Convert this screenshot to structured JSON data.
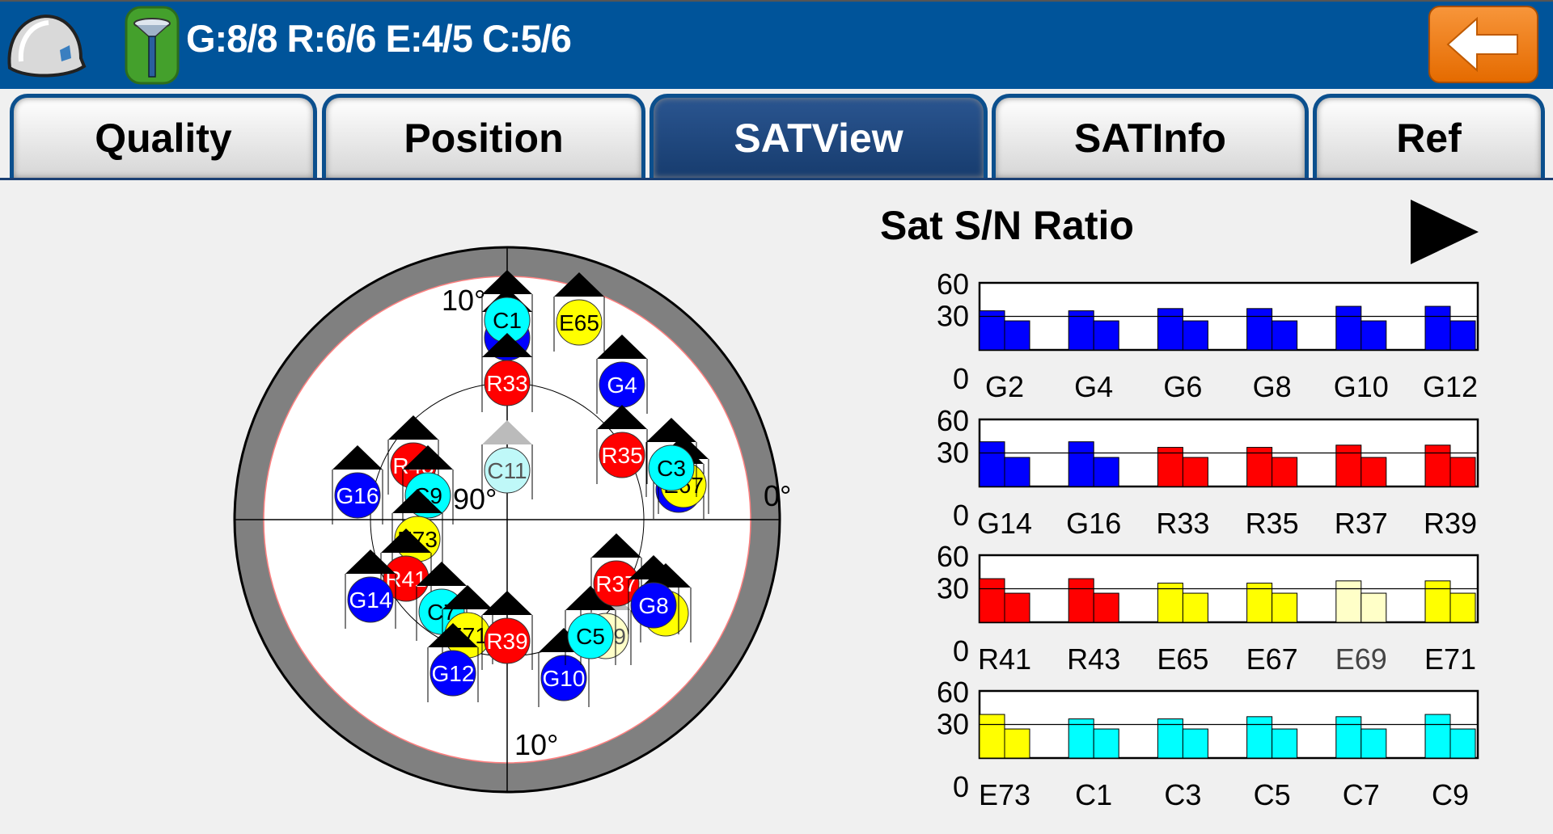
{
  "header": {
    "status": "G:8/8 R:6/6 E:4/5 C:5/6",
    "hat_icon": "hardhat-icon",
    "gps_icon": "gps-antenna-icon",
    "back_icon": "back-arrow-icon",
    "brand_color": "#00549a",
    "back_color": "#f07c1a"
  },
  "tabs": [
    {
      "label": "Quality",
      "active": false
    },
    {
      "label": "Position",
      "active": false
    },
    {
      "label": "SATView",
      "active": true
    },
    {
      "label": "SATInfo",
      "active": false
    },
    {
      "label": "Ref",
      "active": false
    }
  ],
  "skyplot": {
    "labels": {
      "top_elev": "10°",
      "center": "90°",
      "right_az": "0°",
      "bottom_elev": "10°"
    },
    "colors": {
      "G": "#0000ff",
      "R": "#ff0000",
      "E": "#ffff00",
      "C": "#00ffff",
      "E_weak": "#ffffc8",
      "C_weak": "#bff8f8"
    },
    "satellites": [
      {
        "label": "",
        "sys": "G"
      },
      {
        "label": "C1",
        "sys": "C"
      },
      {
        "label": "E65",
        "sys": "E"
      },
      {
        "label": "R33",
        "sys": "R"
      },
      {
        "label": "G4",
        "sys": "G"
      },
      {
        "label": "C11",
        "sys": "C_weak"
      },
      {
        "label": "R35",
        "sys": "R"
      },
      {
        "label": "",
        "sys": "G"
      },
      {
        "label": "E67",
        "sys": "E"
      },
      {
        "label": "C3",
        "sys": "C"
      },
      {
        "label": "G16",
        "sys": "G"
      },
      {
        "label": "R43",
        "sys": "R"
      },
      {
        "label": "C9",
        "sys": "C"
      },
      {
        "label": "E73",
        "sys": "E"
      },
      {
        "label": "R41",
        "sys": "R"
      },
      {
        "label": "G14",
        "sys": "G"
      },
      {
        "label": "C7",
        "sys": "C"
      },
      {
        "label": "E71",
        "sys": "E"
      },
      {
        "label": "R39",
        "sys": "R"
      },
      {
        "label": "G12",
        "sys": "G"
      },
      {
        "label": "G10",
        "sys": "G"
      },
      {
        "label": "E69",
        "sys": "E_weak"
      },
      {
        "label": "C5",
        "sys": "C"
      },
      {
        "label": "R37",
        "sys": "R"
      },
      {
        "label": "",
        "sys": "E"
      },
      {
        "label": "G8",
        "sys": "G"
      }
    ]
  },
  "sn_panel": {
    "title": "Sat S/N Ratio",
    "next_icon": "play-next-icon"
  },
  "chart_data": [
    {
      "type": "bar",
      "ylim": [
        0,
        60
      ],
      "yticks": [
        "60",
        "30",
        "0"
      ],
      "reference_line": 30,
      "categories": [
        "G2",
        "G4",
        "G6",
        "G8",
        "G10",
        "G12"
      ],
      "colors": [
        "#0000ff",
        "#0000ff",
        "#0000ff",
        "#0000ff",
        "#0000ff",
        "#0000ff"
      ],
      "series": [
        {
          "values": [
            35,
            35,
            37,
            37,
            39,
            39
          ]
        },
        {
          "values": [
            26,
            26,
            26,
            26,
            26,
            26
          ]
        }
      ]
    },
    {
      "type": "bar",
      "ylim": [
        0,
        60
      ],
      "yticks": [
        "60",
        "30",
        "0"
      ],
      "reference_line": 30,
      "categories": [
        "G14",
        "G16",
        "R33",
        "R35",
        "R37",
        "R39"
      ],
      "colors": [
        "#0000ff",
        "#0000ff",
        "#ff0000",
        "#ff0000",
        "#ff0000",
        "#ff0000"
      ],
      "series": [
        {
          "values": [
            40,
            40,
            35,
            35,
            37,
            37
          ]
        },
        {
          "values": [
            26,
            26,
            26,
            26,
            26,
            26
          ]
        }
      ]
    },
    {
      "type": "bar",
      "ylim": [
        0,
        60
      ],
      "yticks": [
        "60",
        "30",
        "0"
      ],
      "reference_line": 30,
      "categories": [
        "R41",
        "R43",
        "E65",
        "E67",
        "E69",
        "E71"
      ],
      "colors": [
        "#ff0000",
        "#ff0000",
        "#ffff00",
        "#ffff00",
        "#ffffc8",
        "#ffff00"
      ],
      "series": [
        {
          "values": [
            39,
            39,
            35,
            35,
            37,
            37
          ]
        },
        {
          "values": [
            26,
            26,
            26,
            26,
            26,
            26
          ]
        }
      ]
    },
    {
      "type": "bar",
      "ylim": [
        0,
        60
      ],
      "yticks": [
        "60",
        "30",
        "0"
      ],
      "reference_line": 30,
      "categories": [
        "E73",
        "C1",
        "C3",
        "C5",
        "C7",
        "C9"
      ],
      "colors": [
        "#ffff00",
        "#00ffff",
        "#00ffff",
        "#00ffff",
        "#00ffff",
        "#00ffff"
      ],
      "series": [
        {
          "values": [
            39,
            35,
            35,
            37,
            37,
            39
          ]
        },
        {
          "values": [
            26,
            26,
            26,
            26,
            26,
            26
          ]
        }
      ]
    }
  ]
}
